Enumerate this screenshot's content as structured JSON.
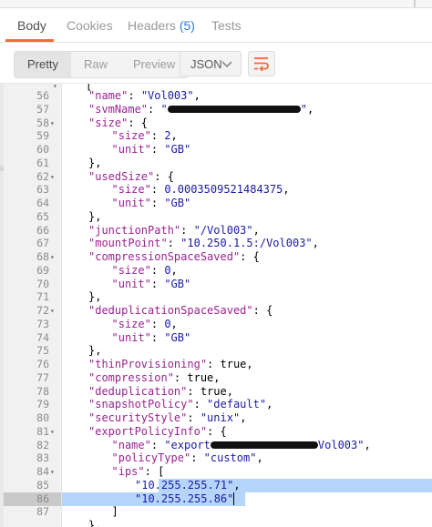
{
  "tabs": [
    {
      "label": "Body",
      "active": true
    },
    {
      "label": "Cookies"
    },
    {
      "label": "Headers",
      "badge": "(5)"
    },
    {
      "label": "Tests"
    }
  ],
  "toolbar": {
    "view_modes": [
      "Pretty",
      "Raw",
      "Preview"
    ],
    "active_mode": "Pretty",
    "format_select": "JSON",
    "wrap_icon": "wrap-lines-icon"
  },
  "colors": {
    "accent": "#f26b3a",
    "selection": "#b5d5fb",
    "key": "#9b2393",
    "value": "#1a1aa6"
  },
  "editor": {
    "lines": [
      {
        "n": "56",
        "fold": false,
        "indent": 1,
        "parts": [
          {
            "t": "\"name\"",
            "c": "k"
          },
          {
            "t": ": ",
            "c": "p"
          },
          {
            "t": "\"Vol003\"",
            "c": "s"
          },
          {
            "t": ",",
            "c": "p"
          }
        ]
      },
      {
        "n": "57",
        "fold": false,
        "indent": 1,
        "parts": [
          {
            "t": "\"svmName\"",
            "c": "k"
          },
          {
            "t": ": ",
            "c": "p"
          },
          {
            "t": "\"",
            "c": "s"
          },
          {
            "redact": 146
          },
          {
            "t": "\"",
            "c": "s"
          },
          {
            "t": ",",
            "c": "p"
          }
        ]
      },
      {
        "n": "58",
        "fold": true,
        "indent": 1,
        "parts": [
          {
            "t": "\"size\"",
            "c": "k"
          },
          {
            "t": ": {",
            "c": "p"
          }
        ]
      },
      {
        "n": "59",
        "fold": false,
        "indent": 2,
        "parts": [
          {
            "t": "\"size\"",
            "c": "k"
          },
          {
            "t": ": ",
            "c": "p"
          },
          {
            "t": "2",
            "c": "n"
          },
          {
            "t": ",",
            "c": "p"
          }
        ]
      },
      {
        "n": "60",
        "fold": false,
        "indent": 2,
        "parts": [
          {
            "t": "\"unit\"",
            "c": "k"
          },
          {
            "t": ": ",
            "c": "p"
          },
          {
            "t": "\"GB\"",
            "c": "s"
          }
        ]
      },
      {
        "n": "61",
        "fold": false,
        "indent": 1,
        "parts": [
          {
            "t": "},",
            "c": "p"
          }
        ]
      },
      {
        "n": "62",
        "fold": true,
        "indent": 1,
        "parts": [
          {
            "t": "\"usedSize\"",
            "c": "k"
          },
          {
            "t": ": {",
            "c": "p"
          }
        ]
      },
      {
        "n": "63",
        "fold": false,
        "indent": 2,
        "parts": [
          {
            "t": "\"size\"",
            "c": "k"
          },
          {
            "t": ": ",
            "c": "p"
          },
          {
            "t": "0.0003509521484375",
            "c": "n"
          },
          {
            "t": ",",
            "c": "p"
          }
        ]
      },
      {
        "n": "64",
        "fold": false,
        "indent": 2,
        "parts": [
          {
            "t": "\"unit\"",
            "c": "k"
          },
          {
            "t": ": ",
            "c": "p"
          },
          {
            "t": "\"GB\"",
            "c": "s"
          }
        ]
      },
      {
        "n": "65",
        "fold": false,
        "indent": 1,
        "parts": [
          {
            "t": "},",
            "c": "p"
          }
        ]
      },
      {
        "n": "66",
        "fold": false,
        "indent": 1,
        "parts": [
          {
            "t": "\"junctionPath\"",
            "c": "k"
          },
          {
            "t": ": ",
            "c": "p"
          },
          {
            "t": "\"/Vol003\"",
            "c": "s"
          },
          {
            "t": ",",
            "c": "p"
          }
        ]
      },
      {
        "n": "67",
        "fold": false,
        "indent": 1,
        "parts": [
          {
            "t": "\"mountPoint\"",
            "c": "k"
          },
          {
            "t": ": ",
            "c": "p"
          },
          {
            "t": "\"10.250.1.5:/Vol003\"",
            "c": "s"
          },
          {
            "t": ",",
            "c": "p"
          }
        ]
      },
      {
        "n": "68",
        "fold": true,
        "indent": 1,
        "parts": [
          {
            "t": "\"compressionSpaceSaved\"",
            "c": "k"
          },
          {
            "t": ": {",
            "c": "p"
          }
        ]
      },
      {
        "n": "69",
        "fold": false,
        "indent": 2,
        "parts": [
          {
            "t": "\"size\"",
            "c": "k"
          },
          {
            "t": ": ",
            "c": "p"
          },
          {
            "t": "0",
            "c": "n"
          },
          {
            "t": ",",
            "c": "p"
          }
        ]
      },
      {
        "n": "70",
        "fold": false,
        "indent": 2,
        "parts": [
          {
            "t": "\"unit\"",
            "c": "k"
          },
          {
            "t": ": ",
            "c": "p"
          },
          {
            "t": "\"GB\"",
            "c": "s"
          }
        ]
      },
      {
        "n": "71",
        "fold": false,
        "indent": 1,
        "parts": [
          {
            "t": "},",
            "c": "p"
          }
        ]
      },
      {
        "n": "72",
        "fold": true,
        "indent": 1,
        "parts": [
          {
            "t": "\"deduplicationSpaceSaved\"",
            "c": "k"
          },
          {
            "t": ": {",
            "c": "p"
          }
        ]
      },
      {
        "n": "73",
        "fold": false,
        "indent": 2,
        "parts": [
          {
            "t": "\"size\"",
            "c": "k"
          },
          {
            "t": ": ",
            "c": "p"
          },
          {
            "t": "0",
            "c": "n"
          },
          {
            "t": ",",
            "c": "p"
          }
        ]
      },
      {
        "n": "74",
        "fold": false,
        "indent": 2,
        "parts": [
          {
            "t": "\"unit\"",
            "c": "k"
          },
          {
            "t": ": ",
            "c": "p"
          },
          {
            "t": "\"GB\"",
            "c": "s"
          }
        ]
      },
      {
        "n": "75",
        "fold": false,
        "indent": 1,
        "parts": [
          {
            "t": "},",
            "c": "p"
          }
        ]
      },
      {
        "n": "76",
        "fold": false,
        "indent": 1,
        "parts": [
          {
            "t": "\"thinProvisioning\"",
            "c": "k"
          },
          {
            "t": ": ",
            "c": "p"
          },
          {
            "t": "true",
            "c": "b"
          },
          {
            "t": ",",
            "c": "p"
          }
        ]
      },
      {
        "n": "77",
        "fold": false,
        "indent": 1,
        "parts": [
          {
            "t": "\"compression\"",
            "c": "k"
          },
          {
            "t": ": ",
            "c": "p"
          },
          {
            "t": "true",
            "c": "b"
          },
          {
            "t": ",",
            "c": "p"
          }
        ]
      },
      {
        "n": "78",
        "fold": false,
        "indent": 1,
        "parts": [
          {
            "t": "\"deduplication\"",
            "c": "k"
          },
          {
            "t": ": ",
            "c": "p"
          },
          {
            "t": "true",
            "c": "b"
          },
          {
            "t": ",",
            "c": "p"
          }
        ]
      },
      {
        "n": "79",
        "fold": false,
        "indent": 1,
        "parts": [
          {
            "t": "\"snapshotPolicy\"",
            "c": "k"
          },
          {
            "t": ": ",
            "c": "p"
          },
          {
            "t": "\"default\"",
            "c": "s"
          },
          {
            "t": ",",
            "c": "p"
          }
        ]
      },
      {
        "n": "80",
        "fold": false,
        "indent": 1,
        "parts": [
          {
            "t": "\"securityStyle\"",
            "c": "k"
          },
          {
            "t": ": ",
            "c": "p"
          },
          {
            "t": "\"unix\"",
            "c": "s"
          },
          {
            "t": ",",
            "c": "p"
          }
        ]
      },
      {
        "n": "81",
        "fold": true,
        "indent": 1,
        "parts": [
          {
            "t": "\"exportPolicyInfo\"",
            "c": "k"
          },
          {
            "t": ": {",
            "c": "p"
          }
        ]
      },
      {
        "n": "82",
        "fold": false,
        "indent": 2,
        "parts": [
          {
            "t": "\"name\"",
            "c": "k"
          },
          {
            "t": ": ",
            "c": "p"
          },
          {
            "t": "\"export",
            "c": "s"
          },
          {
            "redact": 118
          },
          {
            "t": "Vol003\"",
            "c": "s"
          },
          {
            "t": ",",
            "c": "p"
          }
        ]
      },
      {
        "n": "83",
        "fold": false,
        "indent": 2,
        "parts": [
          {
            "t": "\"policyType\"",
            "c": "k"
          },
          {
            "t": ": ",
            "c": "p"
          },
          {
            "t": "\"custom\"",
            "c": "s"
          },
          {
            "t": ",",
            "c": "p"
          }
        ]
      },
      {
        "n": "84",
        "fold": true,
        "indent": 2,
        "parts": [
          {
            "t": "\"ips\"",
            "c": "k"
          },
          {
            "t": ": [",
            "c": "p"
          }
        ]
      },
      {
        "n": "85",
        "fold": false,
        "indent": 3,
        "sel": "partial",
        "parts": [
          {
            "t": "\"10.255.255.71\"",
            "c": "s"
          },
          {
            "t": ",",
            "c": "p"
          }
        ]
      },
      {
        "n": "86",
        "fold": false,
        "indent": 3,
        "sel": "full",
        "cursor": true,
        "parts": [
          {
            "t": "\"10.255.255.86\"",
            "c": "s"
          }
        ]
      },
      {
        "n": "87",
        "fold": false,
        "indent": 2,
        "parts": [
          {
            "t": "]",
            "c": "p"
          }
        ]
      },
      {
        "n": "",
        "fold": false,
        "indent": 1,
        "parts": [
          {
            "t": "},",
            "c": "p"
          }
        ]
      }
    ]
  }
}
